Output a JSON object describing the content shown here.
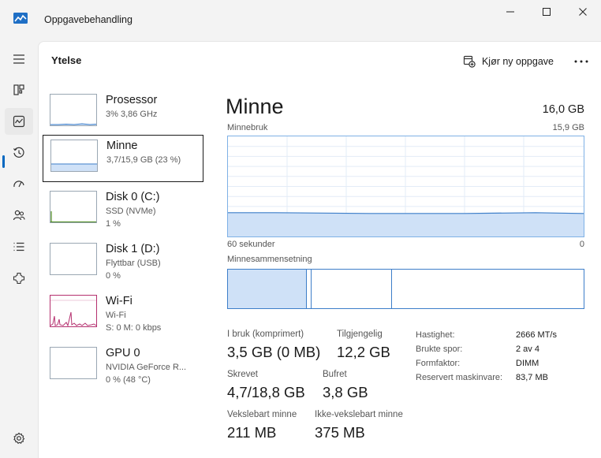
{
  "window": {
    "title": "Oppgavebehandling",
    "controls": [
      "minimize",
      "maximize",
      "close"
    ]
  },
  "nav": {
    "items": [
      {
        "name": "menu-icon"
      },
      {
        "name": "processes-icon"
      },
      {
        "name": "performance-icon",
        "active": true
      },
      {
        "name": "app-history-icon"
      },
      {
        "name": "startup-apps-icon"
      },
      {
        "name": "users-icon"
      },
      {
        "name": "details-icon"
      },
      {
        "name": "services-icon"
      }
    ],
    "settings": {
      "name": "settings-icon"
    }
  },
  "header": {
    "title": "Ytelse",
    "run_task_label": "Kjør ny oppgave"
  },
  "devices": [
    {
      "name": "Prosessor",
      "sub1": "3% 3,86 GHz",
      "sub2": "",
      "sub3": ""
    },
    {
      "name": "Minne",
      "sub1": "3,7/15,9 GB (23 %)",
      "sub2": "",
      "sub3": "",
      "selected": true
    },
    {
      "name": "Disk 0 (C:)",
      "sub1": "SSD (NVMe)",
      "sub2": "1 %",
      "sub3": ""
    },
    {
      "name": "Disk 1 (D:)",
      "sub1": "Flyttbar (USB)",
      "sub2": "0 %",
      "sub3": ""
    },
    {
      "name": "Wi-Fi",
      "sub1": "Wi-Fi",
      "sub2": "S: 0 M: 0 kbps",
      "sub3": ""
    },
    {
      "name": "GPU 0",
      "sub1": "NVIDIA GeForce R...",
      "sub2": "0 % (48 °C)",
      "sub3": ""
    }
  ],
  "detail": {
    "title": "Minne",
    "total": "16,0 GB",
    "usage_label": "Minnebruk",
    "usage_max": "15,9 GB",
    "time_left": "60 sekunder",
    "time_right": "0",
    "composition_label": "Minnesammensetning",
    "usage_level": 0.23,
    "composition_in_use_fraction": 0.22,
    "stats": {
      "in_use_label": "I bruk (komprimert)",
      "in_use_value": "3,5 GB (0 MB)",
      "available_label": "Tilgjengelig",
      "available_value": "12,2 GB",
      "committed_label": "Skrevet",
      "committed_value": "4,7/18,8 GB",
      "cached_label": "Bufret",
      "cached_value": "3,8 GB",
      "paged_label": "Vekslebart minne",
      "paged_value": "211 MB",
      "nonpaged_label": "Ikke-vekslebart minne",
      "nonpaged_value": "375 MB"
    },
    "specs": [
      {
        "key": "Hastighet:",
        "value": "2666 MT/s"
      },
      {
        "key": "Brukte spor:",
        "value": "2 av 4"
      },
      {
        "key": "Formfaktor:",
        "value": "DIMM"
      },
      {
        "key": "Reservert maskinvare:",
        "value": "83,7 MB"
      }
    ]
  },
  "colors": {
    "accent": "#0067c0",
    "memory_fill": "#cfe1f7",
    "memory_line": "#3d7ec9",
    "wifi_line": "#b5306f",
    "disk_line": "#4d8a1e"
  }
}
